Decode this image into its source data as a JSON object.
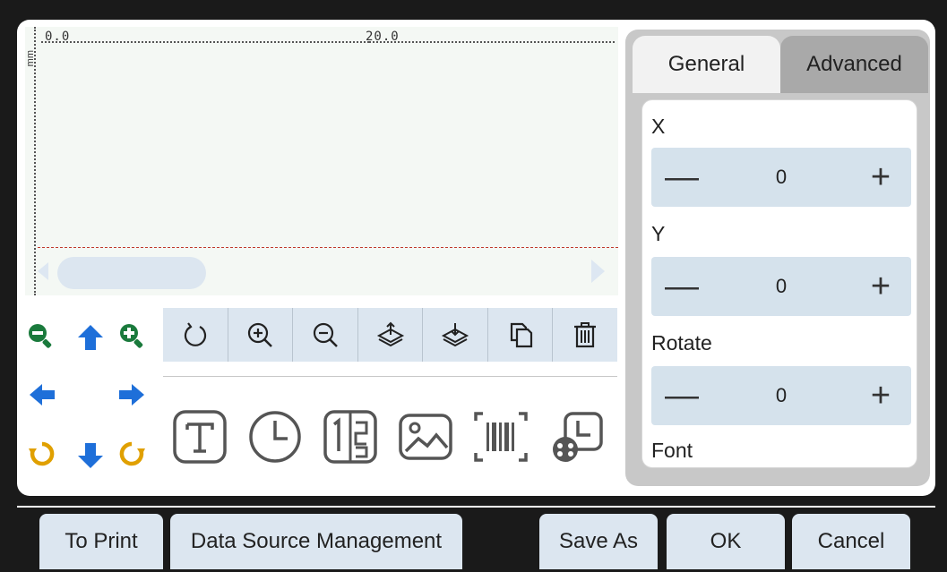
{
  "ruler": {
    "mark_start": "0.0",
    "mark_mid": "20.0",
    "unit": "mm"
  },
  "navigation": {
    "zoom_out": "zoom-out",
    "move_up": "arrow-up",
    "zoom_in": "zoom-in",
    "move_left": "arrow-left",
    "move_right": "arrow-right",
    "rotate_ccw": "rotate-ccw",
    "move_down": "arrow-down",
    "rotate_cw": "rotate-cw"
  },
  "toolbar": [
    {
      "icon": "undo-icon"
    },
    {
      "icon": "zoom-in-icon"
    },
    {
      "icon": "zoom-out-icon"
    },
    {
      "icon": "layer-up-icon"
    },
    {
      "icon": "layer-down-icon"
    },
    {
      "icon": "copy-icon"
    },
    {
      "icon": "delete-icon"
    }
  ],
  "insert_tools": [
    {
      "icon": "text-icon"
    },
    {
      "icon": "clock-icon"
    },
    {
      "icon": "counter-icon"
    },
    {
      "icon": "image-icon"
    },
    {
      "icon": "barcode-icon"
    },
    {
      "icon": "shift-code-icon"
    }
  ],
  "properties": {
    "tabs": {
      "general": "General",
      "advanced": "Advanced"
    },
    "x_label": "X",
    "x_value": "0",
    "y_label": "Y",
    "y_value": "0",
    "rotate_label": "Rotate",
    "rotate_value": "0",
    "font_label": "Font",
    "minus": "—",
    "plus": "+"
  },
  "buttons": {
    "to_print": "To Print",
    "data_source": "Data Source Management",
    "save_as": "Save As",
    "ok": "OK",
    "cancel": "Cancel"
  },
  "colors": {
    "zoom_green": "#1a7a3c",
    "arrow_blue": "#1e6fd9",
    "rotate_orange": "#e0a000",
    "button_bg": "#dce6f0"
  }
}
